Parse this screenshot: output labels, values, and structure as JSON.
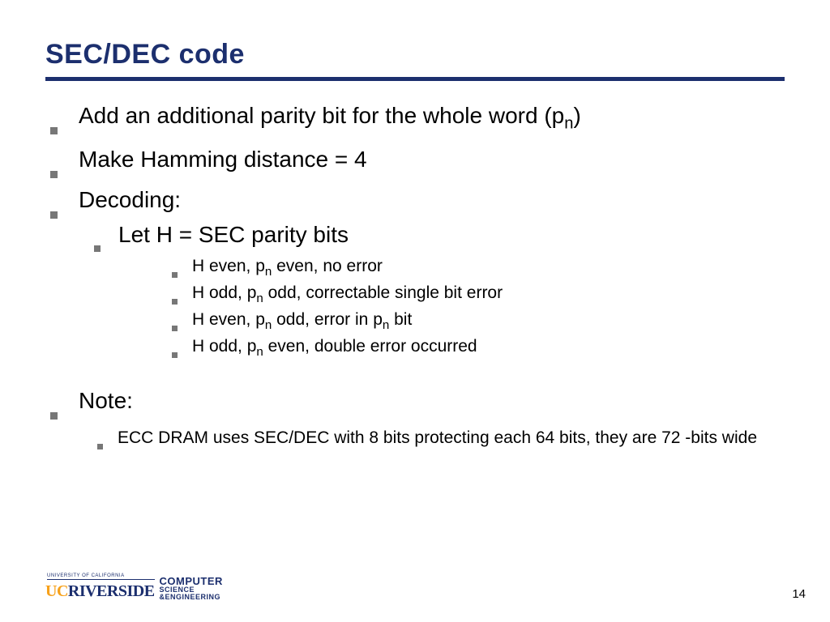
{
  "title": "SEC/DEC code",
  "bullets": {
    "b1_pre": "Add an additional parity bit for the whole word (p",
    "b1_sub": "n",
    "b1_post": ")",
    "b2": "Make Hamming distance = 4",
    "b3": "Decoding:",
    "b3a": "Let H = SEC parity bits",
    "cases": {
      "c1_a": "H even, p",
      "c1_sub": "n",
      "c1_b": " even, no error",
      "c2_a": "H odd, p",
      "c2_sub": "n",
      "c2_b": " odd, correctable single bit error",
      "c3_a": "H even, p",
      "c3_sub1": "n",
      "c3_b": " odd, error in p",
      "c3_sub2": "n",
      "c3_c": " bit",
      "c4_a": "H odd, p",
      "c4_sub": "n",
      "c4_b": " even, double error occurred"
    },
    "note": "Note:",
    "note_text": "ECC DRAM uses SEC/DEC with 8 bits protecting each 64 bits, they are 72 -bits wide"
  },
  "footer": {
    "univ_small": "UNIVERSITY OF CALIFORNIA",
    "logo_uc": "UC",
    "logo_rv": "RIVERSIDE",
    "dept_l1": "COMPUTER",
    "dept_l2a": "SCIENCE",
    "dept_l2b": "&ENGINEERING",
    "page": "14"
  }
}
